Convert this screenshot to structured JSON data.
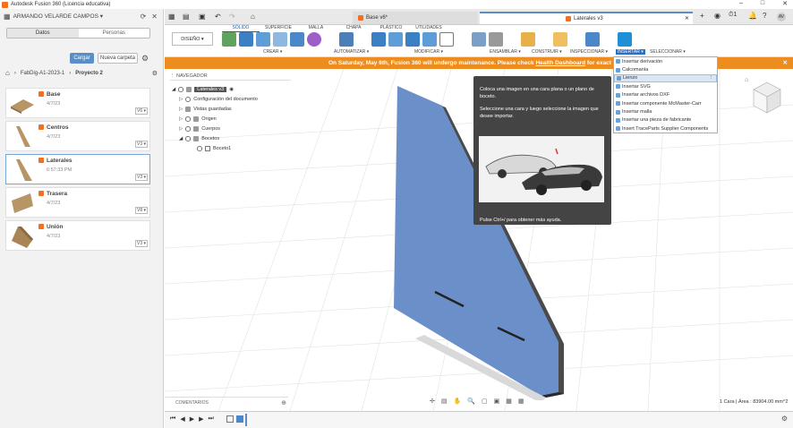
{
  "titlebar": {
    "title": "Autodesk Fusion 360 (Licencia educativa)"
  },
  "user": {
    "name": "ARMANDO VELARDE CAMPOS ▾",
    "initials": "AV"
  },
  "panel": {
    "tab_data": "Datos",
    "tab_people": "Personas",
    "upload": "Cargar",
    "new_folder": "Nueva carpeta",
    "breadcrumb": [
      "FabDig-A1-2023-1",
      "Proyecto 2"
    ],
    "files": [
      {
        "name": "Base",
        "date": "4/7/23",
        "version": "V6 ▾"
      },
      {
        "name": "Centros",
        "date": "4/7/23",
        "version": "V3 ▾"
      },
      {
        "name": "Laterales",
        "date": "6:57:33 PM",
        "version": "V3 ▾"
      },
      {
        "name": "Trasera",
        "date": "4/7/23",
        "version": "V8 ▾"
      },
      {
        "name": "Unión",
        "date": "4/7/23",
        "version": "V3 ▾"
      }
    ]
  },
  "doc_tabs": [
    {
      "label": "Base v6*"
    },
    {
      "label": "Laterales v3"
    }
  ],
  "toolbar": {
    "workspace": "DISEÑO ▾",
    "tabs": [
      "SÓLIDO",
      "SUPERFICIE",
      "MALLA",
      "CHAPA",
      "PLÁSTICO",
      "UTILIDADES"
    ],
    "groups": [
      "CREAR ▾",
      "AUTOMATIZAR ▾",
      "MODIFICAR ▾",
      "ENSAMBLAR ▾",
      "CONSTRUIR ▾",
      "INSPECCIONAR ▾",
      "INSERTAR ▾",
      "SELECCIONAR ▾"
    ]
  },
  "banner": {
    "text_pre": "On Saturday, May 6th, Fusion 360 will undergo maintenance. Please check ",
    "link": "Health Dashboard",
    "text_post": " for exact timi"
  },
  "browser": {
    "title": "NAVEGADOR",
    "root": "Laterales v3",
    "items": [
      "Configuración del documento",
      "Vistas guardadas",
      "Origen",
      "Cuerpos",
      "Bocetos",
      "Boceto1"
    ]
  },
  "tooltip": {
    "line1": "Coloca una imagen en una cara plana o un plano de boceto.",
    "line2": "Seleccione una cara y luego seleccione la imagen que desee importar.",
    "help": "Pulse Ctrl+/ para obtener más ayuda."
  },
  "insert_menu": {
    "items": [
      "Insertar derivación",
      "Calcomanía",
      "Lienzo",
      "Insertar SVG",
      "Insertar archivos DXF",
      "Insertar componente McMaster-Carr",
      "Insertar malla",
      "Insertar una pieza de fabricante",
      "Insert TraceParts Supplier Components"
    ],
    "highlighted": "Lienzo"
  },
  "comments": {
    "label": "COMENTARIOS"
  },
  "status": {
    "text": "1 Cara | Área : 83904.00 mm^2"
  },
  "colors": {
    "accent": "#0a62c6",
    "banner": "#ed8c1f",
    "body": "#6a8fc9"
  }
}
